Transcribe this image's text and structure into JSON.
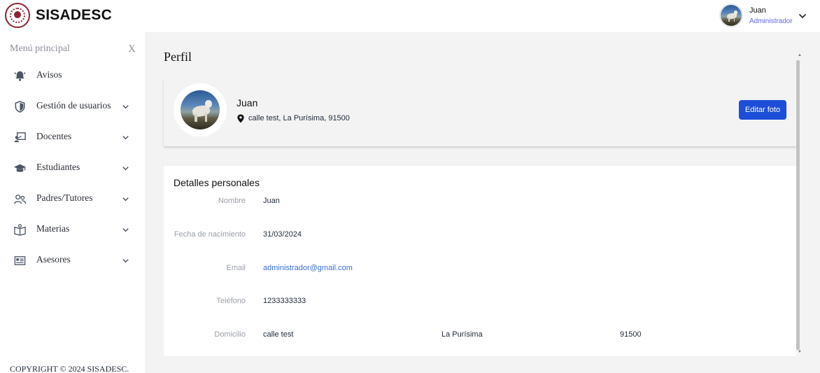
{
  "app": {
    "brand": "SISADESC"
  },
  "user": {
    "name": "Juan",
    "role": "Administrador",
    "avatar_icon": "user-avatar-photo"
  },
  "sidebar": {
    "title": "Menú principal",
    "close": "X",
    "items": [
      {
        "label": "Avisos",
        "icon": "bell-icon",
        "expandable": false
      },
      {
        "label": "Gestión de usuarios",
        "icon": "shield-icon",
        "expandable": true
      },
      {
        "label": "Docentes",
        "icon": "teacher-icon",
        "expandable": true
      },
      {
        "label": "Estudiantes",
        "icon": "graduation-cap-icon",
        "expandable": true
      },
      {
        "label": "Padres/Tutores",
        "icon": "users-icon",
        "expandable": true
      },
      {
        "label": "Materias",
        "icon": "book-icon",
        "expandable": true
      },
      {
        "label": "Asesores",
        "icon": "id-card-icon",
        "expandable": true
      }
    ],
    "copyright": "COPYRIGHT © 2024 SISADESC."
  },
  "main": {
    "title": "Perfil",
    "profile": {
      "name": "Juan",
      "location": "calle test, La Purísima, 91500",
      "edit_label": "Editar foto"
    },
    "details": {
      "title": "Detalles personales",
      "rows": [
        {
          "label": "Nombre",
          "value": "Juan"
        },
        {
          "label": "Fecha de nacimiento",
          "value": "31/03/2024"
        },
        {
          "label": "Email",
          "value": "administrador@gmail.com"
        },
        {
          "label": "Teléfono",
          "value": "1233333333"
        },
        {
          "label": "Domicilio",
          "value": "calle test",
          "value2": "La Purísima",
          "value3": "91500"
        }
      ]
    }
  },
  "colors": {
    "accent": "#1d4ed8",
    "role": "#6366f1",
    "link": "#3b6fd8",
    "brand_seal": "#8a2432"
  }
}
